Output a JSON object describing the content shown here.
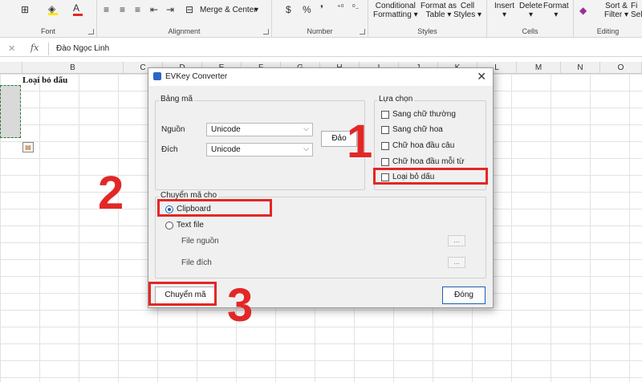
{
  "ribbon": {
    "font_group": "Font",
    "alignment_group": "Alignment",
    "merge_center": "Merge & Center",
    "number_group": "Number",
    "number_symbols": [
      "$",
      "%",
      "❜"
    ],
    "conditional_formatting": [
      "Conditional",
      "Formatting"
    ],
    "format_as_table": [
      "Format as",
      "Table"
    ],
    "cell_styles": [
      "Cell",
      "Styles"
    ],
    "styles_group": "Styles",
    "insert": "Insert",
    "delete": "Delete",
    "format": "Format",
    "cells_group": "Cells",
    "sort_filter": [
      "Sort &",
      "Filter"
    ],
    "find_select": [
      "Fi",
      "Sel"
    ],
    "editing_group": "Editing"
  },
  "formula_bar": {
    "cancel": "✕",
    "fx": "fx",
    "value": "Đào Ngọc Linh"
  },
  "columns": [
    "B",
    "C",
    "D",
    "E",
    "F",
    "G",
    "H",
    "I",
    "J",
    "K",
    "L",
    "M",
    "N",
    "O"
  ],
  "cells": {
    "B1": "Loại bỏ dấu"
  },
  "dialog": {
    "title": "EVKey Converter",
    "close": "✕",
    "bang_ma": "Bảng mã",
    "nguon_label": "Nguồn",
    "nguon_value": "Unicode",
    "dich_label": "Đích",
    "dich_value": "Unicode",
    "swap_button": "Đảo",
    "lua_chon": "Lựa chọn",
    "options": [
      "Sang chữ thường",
      "Sang chữ hoa",
      "Chữ hoa đầu câu",
      "Chữ hoa đầu mỗi từ",
      "Loại bỏ dấu"
    ],
    "chuyen_ma_cho": "Chuyển mã cho",
    "clipboard": "Clipboard",
    "text_file": "Text file",
    "file_nguon": "File nguồn",
    "file_dich": "File đích",
    "browse": "...",
    "convert_button": "Chuyển mã",
    "close_button": "Đóng"
  },
  "annotations": [
    "1",
    "2",
    "3"
  ],
  "colors": {
    "annotation": "#e32727",
    "radio_selected": "#1b5fb5"
  }
}
